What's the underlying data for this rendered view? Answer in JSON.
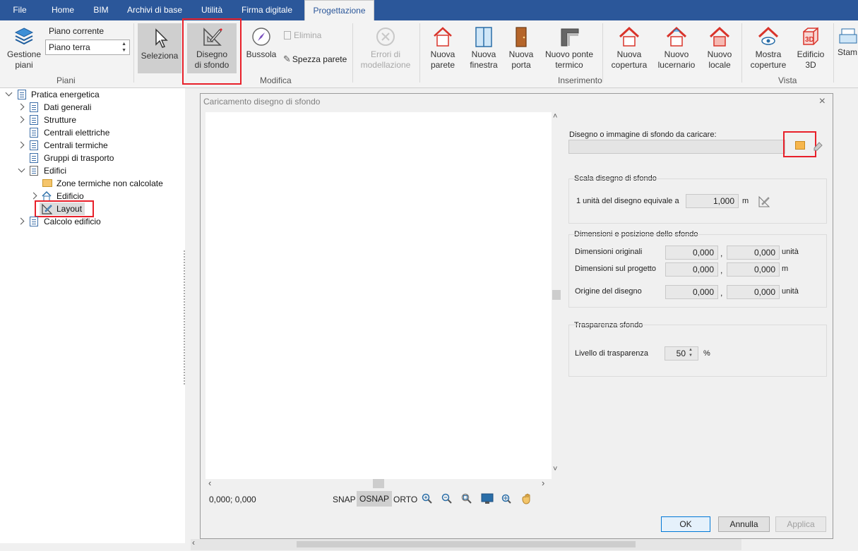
{
  "menu": {
    "items": [
      {
        "label": "File"
      },
      {
        "label": "Home"
      },
      {
        "label": "BIM"
      },
      {
        "label": "Archivi di base"
      },
      {
        "label": "Utilità"
      },
      {
        "label": "Firma digitale"
      },
      {
        "label": "Progettazione"
      }
    ]
  },
  "ribbon": {
    "gestione_piani": "Gestione piani",
    "piano_corrente_label": "Piano corrente",
    "piano_corrente_value": "Piano terra",
    "group_piani": "Piani",
    "seleziona": "Seleziona",
    "disegno_sfondo": "Disegno di sfondo",
    "bussola": "Bussola",
    "elimina": "Elimina",
    "spezza_parete": "Spezza parete",
    "errori": "Errori di modellazione",
    "group_modifica": "Modifica",
    "nuova_parete": "Nuova parete",
    "nuova_finestra": "Nuova finestra",
    "nuova_porta": "Nuova porta",
    "nuovo_ponte": "Nuovo ponte termico",
    "nuova_copertura": "Nuova copertura",
    "nuovo_lucernario": "Nuovo lucernario",
    "nuovo_locale": "Nuovo locale",
    "group_inserimento": "Inserimento",
    "mostra_coperture": "Mostra coperture",
    "edificio_3d": "Edificio 3D",
    "group_vista": "Vista",
    "stam": "Stam",
    "icon_3d": "3D"
  },
  "tree": {
    "items": [
      {
        "label": "Pratica energetica"
      },
      {
        "label": "Dati generali"
      },
      {
        "label": "Strutture"
      },
      {
        "label": "Centrali elettriche"
      },
      {
        "label": "Centrali termiche"
      },
      {
        "label": "Gruppi di trasporto"
      },
      {
        "label": "Edifici"
      },
      {
        "label": "Zone termiche non calcolate"
      },
      {
        "label": "Edificio"
      },
      {
        "label": "Layout"
      },
      {
        "label": "Calcolo edificio"
      }
    ]
  },
  "dialog": {
    "title": "Caricamento disegno di sfondo",
    "file_label": "Disegno o immagine di sfondo da caricare:",
    "file_value": "",
    "scale_group": "Scala disegno di sfondo",
    "scale_label": "1 unità del disegno equivale a",
    "scale_value": "1,000",
    "scale_unit": "m",
    "dim_group": "Dimensioni e posizione dello sfondo",
    "dim_orig_label": "Dimensioni originali",
    "dim_orig_x": "0,000",
    "dim_orig_y": "0,000",
    "dim_orig_unit": "unità",
    "dim_proj_label": "Dimensioni sul progetto",
    "dim_proj_x": "0,000",
    "dim_proj_y": "0,000",
    "dim_proj_unit": "m",
    "origin_label": "Origine del disegno",
    "origin_x": "0,000",
    "origin_y": "0,000",
    "origin_unit": "unità",
    "comma": ",",
    "transp_group": "Trasparenza sfondo",
    "transp_label": "Livello di trasparenza",
    "transp_value": "50",
    "transp_unit": "%",
    "coords": "0,000; 0,000",
    "snap": "SNAP",
    "osnap": "OSNAP",
    "orto": "ORTO",
    "ok": "OK",
    "annulla": "Annulla",
    "applica": "Applica"
  }
}
